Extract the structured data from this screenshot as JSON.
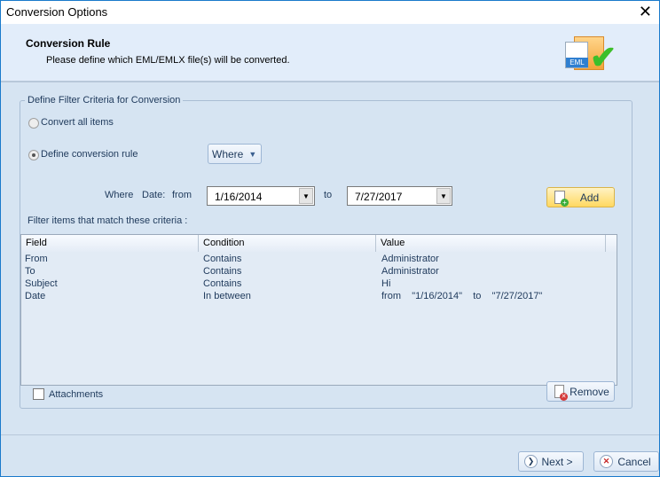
{
  "window": {
    "title": "Conversion Options",
    "close_icon": "close-icon"
  },
  "header": {
    "title": "Conversion Rule",
    "subtitle": "Please define which EML/EMLX file(s) will be converted.",
    "icon_label": "EML"
  },
  "group": {
    "legend": "Define Filter Criteria for Conversion",
    "convert_all_label": "Convert all items",
    "define_rule_label": "Define conversion rule",
    "selected_option": "Define conversion rule",
    "where_button": "Where",
    "where_label": "Where",
    "field_label": "Date:",
    "from_label": "from",
    "from_value": "1/16/2014",
    "to_label": "to",
    "to_value": "7/27/2017",
    "add_button": "Add",
    "filter_label": "Filter items that match these criteria :",
    "columns": [
      "Field",
      "Condition",
      "Value"
    ],
    "rows": [
      {
        "field": "From",
        "condition": "Contains",
        "value": "Administrator"
      },
      {
        "field": "To",
        "condition": "Contains",
        "value": "Administrator"
      },
      {
        "field": "Subject",
        "condition": "Contains",
        "value": "Hi"
      },
      {
        "field": "Date",
        "condition": "In between",
        "value": "from    \"1/16/2014\"    to    \"7/27/2017\""
      }
    ],
    "attachments_label": "Attachments",
    "attachments_checked": false,
    "remove_button": "Remove"
  },
  "footer": {
    "next_button": "Next >",
    "cancel_button": "Cancel"
  }
}
